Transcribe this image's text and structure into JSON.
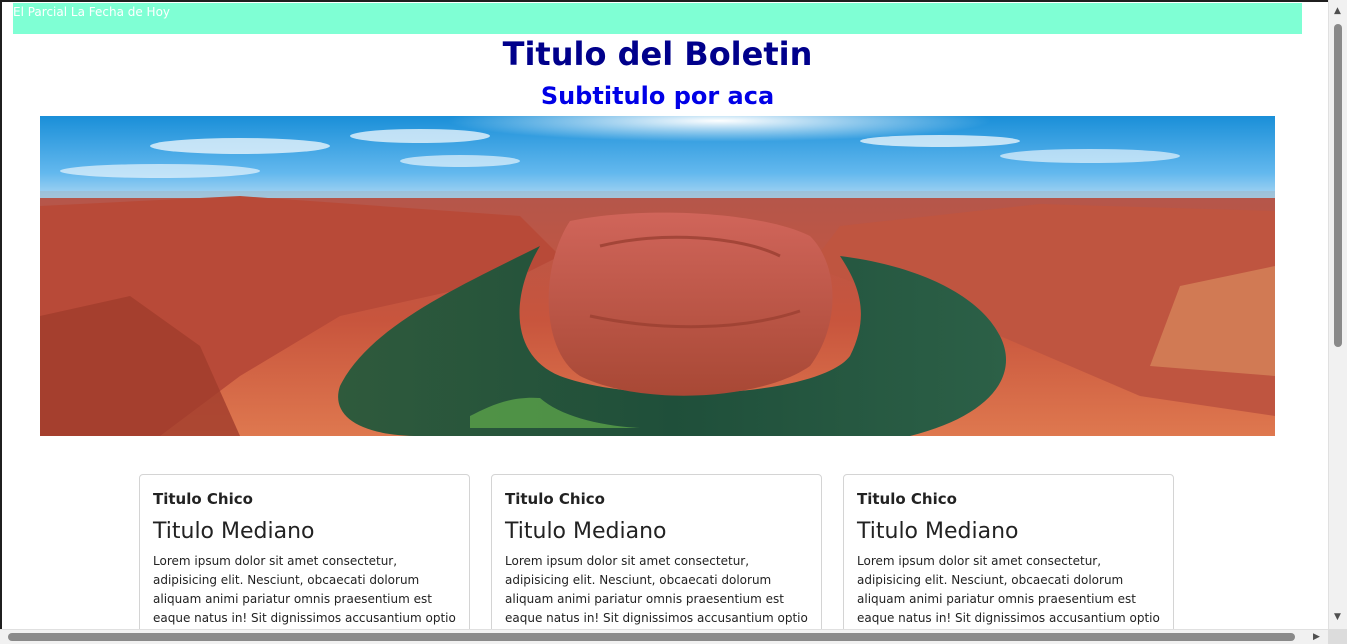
{
  "header": {
    "bar_text": "El Parcial La Fecha de Hoy",
    "bar_color": "#7fffd4"
  },
  "newsletter": {
    "title": "Titulo del Boletin",
    "subtitle": "Subtitulo por aca",
    "hero_image": "canyon-river-bend-image"
  },
  "cards": [
    {
      "small_title": "Titulo Chico",
      "medium_title": "Titulo Mediano",
      "body": "Lorem ipsum dolor sit amet consectetur, adipisicing elit. Nesciunt, obcaecati dolorum aliquam animi pariatur omnis praesentium est eaque natus in! Sit dignissimos accusantium optio exercitationem"
    },
    {
      "small_title": "Titulo Chico",
      "medium_title": "Titulo Mediano",
      "body": "Lorem ipsum dolor sit amet consectetur, adipisicing elit. Nesciunt, obcaecati dolorum aliquam animi pariatur omnis praesentium est eaque natus in! Sit dignissimos accusantium optio exercitationem"
    },
    {
      "small_title": "Titulo Chico",
      "medium_title": "Titulo Mediano",
      "body": "Lorem ipsum dolor sit amet consectetur, adipisicing elit. Nesciunt, obcaecati dolorum aliquam animi pariatur omnis praesentium est eaque natus in! Sit dignissimos accusantium optio exercitationem"
    }
  ],
  "colors": {
    "title": "#00008b",
    "subtitle": "#0000e6"
  },
  "icons": {
    "scroll_up": "arrow-up-icon",
    "scroll_down": "arrow-down-icon",
    "scroll_left": "arrow-left-icon",
    "scroll_right": "arrow-right-icon"
  }
}
